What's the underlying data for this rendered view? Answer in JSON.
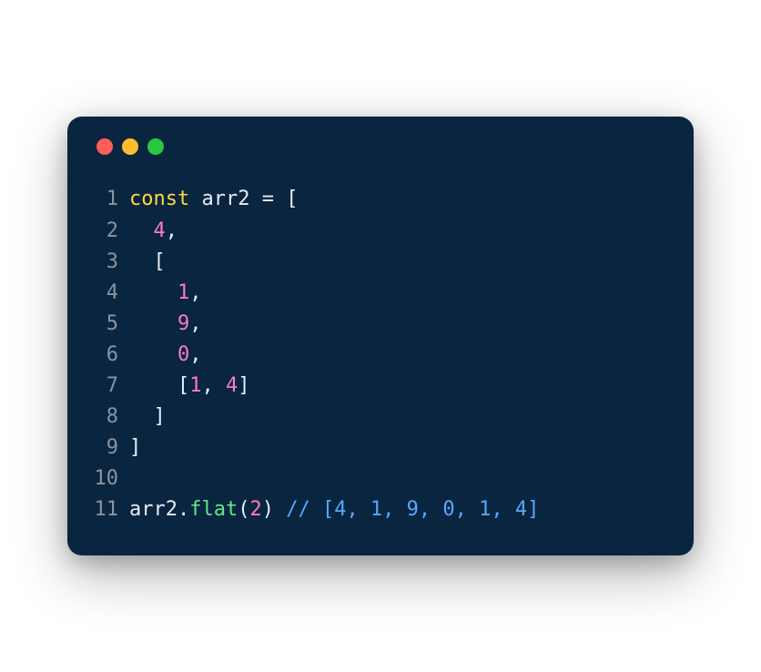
{
  "traffic_lights": {
    "red": "red",
    "yellow": "yellow",
    "green": "green"
  },
  "code": {
    "lines": [
      {
        "num": "1",
        "tokens": [
          {
            "t": "keyword",
            "v": "const"
          },
          {
            "t": "variable",
            "v": " arr2 "
          },
          {
            "t": "punctuation",
            "v": "= ["
          }
        ]
      },
      {
        "num": "2",
        "tokens": [
          {
            "t": "punctuation",
            "v": "  "
          },
          {
            "t": "number",
            "v": "4"
          },
          {
            "t": "punctuation",
            "v": ","
          }
        ]
      },
      {
        "num": "3",
        "tokens": [
          {
            "t": "punctuation",
            "v": "  ["
          }
        ]
      },
      {
        "num": "4",
        "tokens": [
          {
            "t": "punctuation",
            "v": "    "
          },
          {
            "t": "number",
            "v": "1"
          },
          {
            "t": "punctuation",
            "v": ","
          }
        ]
      },
      {
        "num": "5",
        "tokens": [
          {
            "t": "punctuation",
            "v": "    "
          },
          {
            "t": "number",
            "v": "9"
          },
          {
            "t": "punctuation",
            "v": ","
          }
        ]
      },
      {
        "num": "6",
        "tokens": [
          {
            "t": "punctuation",
            "v": "    "
          },
          {
            "t": "number",
            "v": "0"
          },
          {
            "t": "punctuation",
            "v": ","
          }
        ]
      },
      {
        "num": "7",
        "tokens": [
          {
            "t": "punctuation",
            "v": "    ["
          },
          {
            "t": "number",
            "v": "1"
          },
          {
            "t": "punctuation",
            "v": ", "
          },
          {
            "t": "number",
            "v": "4"
          },
          {
            "t": "punctuation",
            "v": "]"
          }
        ]
      },
      {
        "num": "8",
        "tokens": [
          {
            "t": "punctuation",
            "v": "  ]"
          }
        ]
      },
      {
        "num": "9",
        "tokens": [
          {
            "t": "punctuation",
            "v": "]"
          }
        ]
      },
      {
        "num": "10",
        "tokens": []
      },
      {
        "num": "11",
        "tokens": [
          {
            "t": "variable",
            "v": "arr2"
          },
          {
            "t": "punctuation",
            "v": "."
          },
          {
            "t": "method",
            "v": "flat"
          },
          {
            "t": "punctuation",
            "v": "("
          },
          {
            "t": "number",
            "v": "2"
          },
          {
            "t": "punctuation",
            "v": ") "
          },
          {
            "t": "comment",
            "v": "// [4, 1, 9, 0, 1, 4]"
          }
        ]
      }
    ]
  }
}
